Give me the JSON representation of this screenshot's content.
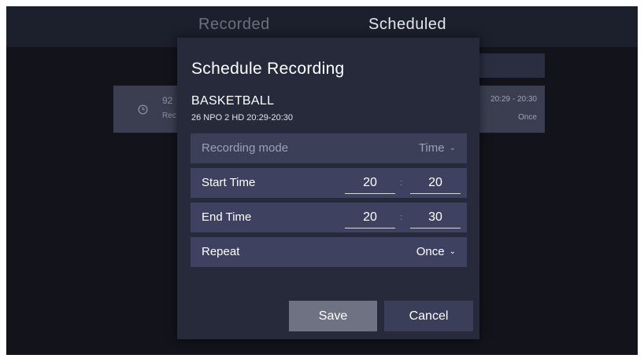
{
  "tabs": {
    "recorded": "Recorded",
    "scheduled": "Scheduled"
  },
  "background_card": {
    "number_partial": "92",
    "rec_partial": "Rec",
    "time": "20:29 - 20:30",
    "repeat": "Once"
  },
  "dialog": {
    "title": "Schedule Recording",
    "program_title": "BASKETBALL",
    "program_info": "26 NPO 2 HD  20:29-20:30",
    "recording_mode": {
      "label": "Recording mode",
      "value": "Time"
    },
    "start_time": {
      "label": "Start Time",
      "hour": "20",
      "minute": "20"
    },
    "end_time": {
      "label": "End Time",
      "hour": "20",
      "minute": "30"
    },
    "repeat": {
      "label": "Repeat",
      "value": "Once"
    },
    "time_separator": ":",
    "save_label": "Save",
    "cancel_label": "Cancel"
  },
  "colors": {
    "screen_bg": "#12131b",
    "dialog_bg": "#272a3b",
    "row_bg": "#3e4260",
    "save_bg": "#6e7283",
    "cancel_bg": "#3a3e58"
  }
}
